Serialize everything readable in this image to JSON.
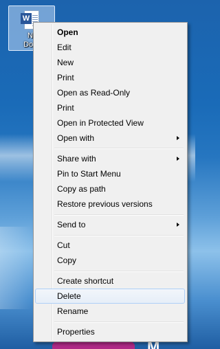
{
  "desktop": {
    "icon": {
      "app_badge": "W",
      "label_line1": "Ne",
      "label_line2": "Docu"
    },
    "logo_text": "M"
  },
  "context_menu": {
    "items": [
      {
        "label": "Open",
        "bold": true
      },
      {
        "label": "Edit"
      },
      {
        "label": "New"
      },
      {
        "label": "Print"
      },
      {
        "label": "Open as Read-Only"
      },
      {
        "label": "Print"
      },
      {
        "label": "Open in Protected View"
      },
      {
        "label": "Open with",
        "submenu": true
      },
      {
        "label": "Share with",
        "submenu": true
      },
      {
        "label": "Pin to Start Menu"
      },
      {
        "label": "Copy as path"
      },
      {
        "label": "Restore previous versions"
      },
      {
        "label": "Send to",
        "submenu": true
      },
      {
        "label": "Cut"
      },
      {
        "label": "Copy"
      },
      {
        "label": "Create shortcut"
      },
      {
        "label": "Delete",
        "highlighted": true
      },
      {
        "label": "Rename"
      },
      {
        "label": "Properties"
      }
    ]
  },
  "colors": {
    "menu_background": "#f0f0f0",
    "menu_border": "#979797",
    "highlight_border": "#aecff7",
    "desktop_blue": "#1c63ad",
    "word_blue": "#2a5699"
  }
}
